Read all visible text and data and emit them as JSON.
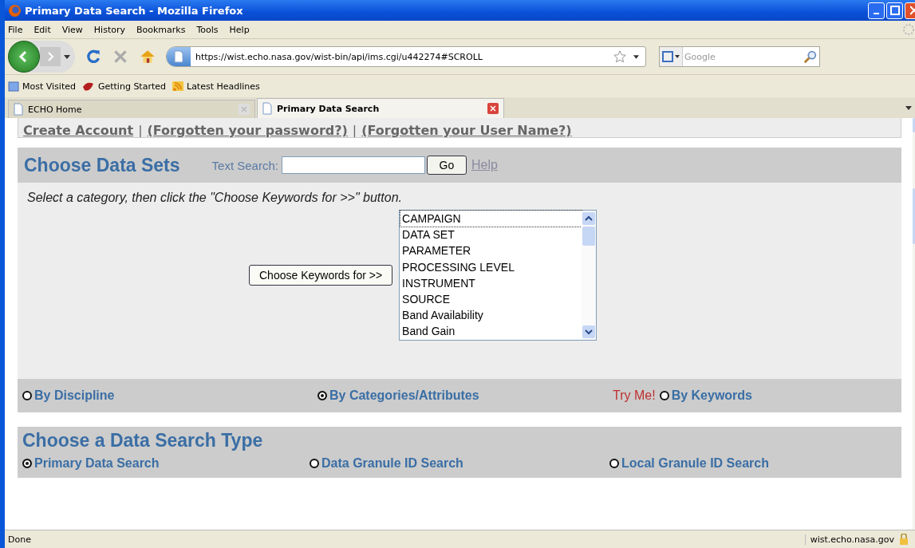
{
  "window": {
    "title": "Primary Data Search - Mozilla Firefox"
  },
  "menu": [
    "File",
    "Edit",
    "View",
    "History",
    "Bookmarks",
    "Tools",
    "Help"
  ],
  "navigation": {
    "url": "https://wist.echo.nasa.gov/wist-bin/api/ims.cgi/u442274#SCROLL",
    "search_placeholder": "Google"
  },
  "bookmarks": [
    "Most Visited",
    "Getting Started",
    "Latest Headlines"
  ],
  "tabs": [
    {
      "label": "ECHO Home",
      "selected": false
    },
    {
      "label": "Primary Data Search",
      "selected": true
    }
  ],
  "account_links": [
    {
      "kind": "link",
      "text": "Create Account"
    },
    {
      "kind": "separator",
      "text": "|"
    },
    {
      "kind": "link",
      "text": "(Forgotten your password?)"
    },
    {
      "kind": "separator",
      "text": "|"
    },
    {
      "kind": "link",
      "text": "(Forgotten your User Name?)"
    }
  ],
  "data_sets": {
    "title": "Choose Data Sets",
    "text_search_label": "Text Search:",
    "go_button": "Go",
    "help_link": "Help",
    "instruction": "Select a category, then click the \"Choose Keywords for >>\" button.",
    "keywords_button": "Choose Keywords for >>",
    "categories": [
      "CAMPAIGN",
      "DATA SET",
      "PARAMETER",
      "PROCESSING LEVEL",
      "INSTRUMENT",
      "SOURCE",
      "Band Availability",
      "Band Gain"
    ],
    "try_me": "Try Me!",
    "modes": [
      {
        "label": "By Discipline",
        "selected": false
      },
      {
        "label": "By Categories/Attributes",
        "selected": true
      },
      {
        "label": "By Keywords",
        "selected": false
      }
    ]
  },
  "search_type": {
    "title": "Choose a Data Search Type",
    "options": [
      {
        "label": "Primary Data Search",
        "selected": true
      },
      {
        "label": "Data Granule ID Search",
        "selected": false
      },
      {
        "label": "Local Granule ID Search",
        "selected": false
      }
    ]
  },
  "status_bar": {
    "text": "Done",
    "host": "wist.echo.nasa.gov"
  }
}
